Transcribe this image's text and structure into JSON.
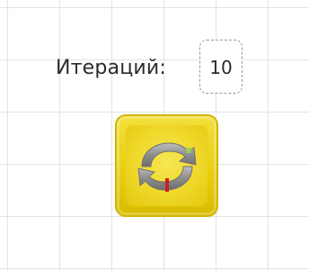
{
  "iterations": {
    "label": "Итераций:",
    "value": "10"
  },
  "block": {
    "icon": "loop-cycle-icon",
    "fill_color": "#e8cf12",
    "arrow_color": "#8e8e8e",
    "marker_color": "#cc1f1f",
    "accent_color": "#9ccf5a"
  }
}
